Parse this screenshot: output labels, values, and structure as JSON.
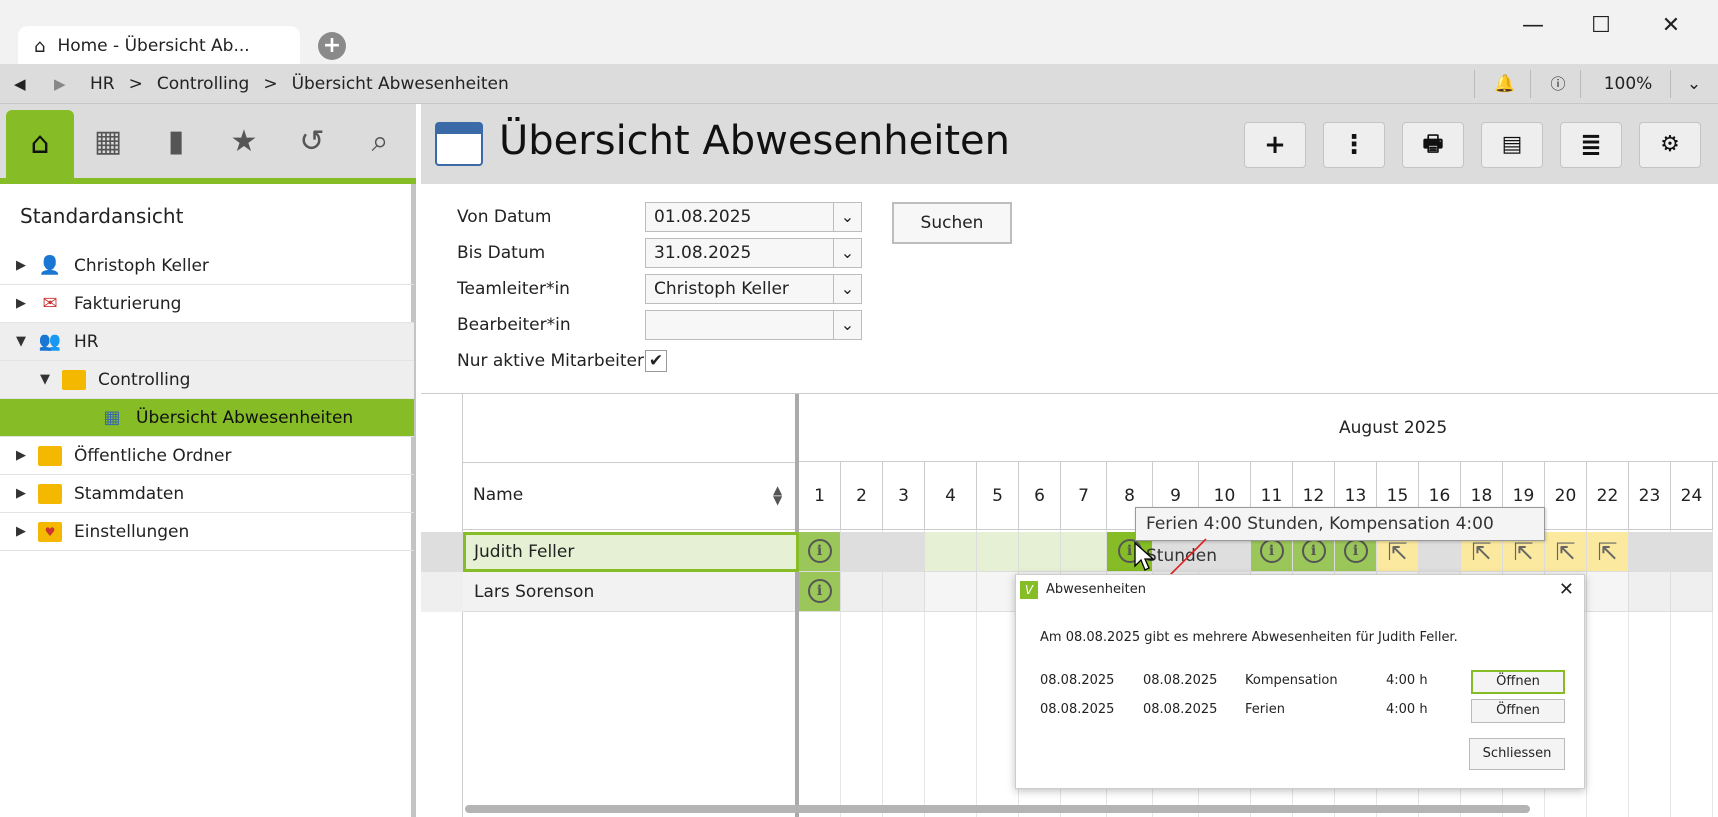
{
  "window": {
    "tab_title": "Home - Übersicht Ab...",
    "minimize": "—",
    "maximize": "☐",
    "close": "✕"
  },
  "breadcrumb": {
    "items": [
      "HR",
      ">",
      "Controlling",
      ">",
      "Übersicht Abwesenheiten"
    ],
    "zoom": "100%"
  },
  "sidebar": {
    "title": "Standardansicht",
    "icons": [
      "home-icon",
      "calendar-icon",
      "bar-chart-icon",
      "star-icon",
      "history-icon",
      "search-icon"
    ],
    "tree": [
      {
        "label": "Christoph Keller",
        "toggle": "▶",
        "icon": "user-icon"
      },
      {
        "label": "Fakturierung",
        "toggle": "▶",
        "icon": "invoice-icon"
      },
      {
        "label": "HR",
        "toggle": "▼",
        "icon": "group-icon"
      },
      {
        "label": "Controlling",
        "toggle": "▼",
        "icon": "folder-icon"
      },
      {
        "label": "Übersicht Abwesenheiten",
        "toggle": "",
        "icon": "calendar-icon"
      },
      {
        "label": "Öffentliche Ordner",
        "toggle": "▶",
        "icon": "folder-icon"
      },
      {
        "label": "Stammdaten",
        "toggle": "▶",
        "icon": "folder-icon"
      },
      {
        "label": "Einstellungen",
        "toggle": "▶",
        "icon": "settings-folder-icon"
      }
    ]
  },
  "header": {
    "title": "Übersicht Abwesenheiten"
  },
  "toolbar": [
    "+",
    "⋮",
    "🖶",
    "▤",
    "≣",
    "⚙"
  ],
  "filters": {
    "von_label": "Von Datum",
    "von_value": "01.08.2025",
    "bis_label": "Bis Datum",
    "bis_value": "31.08.2025",
    "team_label": "Teamleiter*in",
    "team_value": "Christoph Keller",
    "bearb_label": "Bearbeiter*in",
    "bearb_value": "",
    "aktiv_label": "Nur aktive Mitarbeiter",
    "aktiv_checked": "✔",
    "search_label": "Suchen"
  },
  "grid": {
    "month": "August 2025",
    "name_header": "Name",
    "days": [
      "1",
      "2",
      "3",
      "4",
      "5",
      "6",
      "7",
      "8",
      "9",
      "10",
      "11",
      "12",
      "13",
      "15",
      "16",
      "18",
      "19",
      "20",
      "22",
      "23",
      "24"
    ],
    "rows": [
      {
        "name": "Judith Feller"
      },
      {
        "name": "Lars Sorenson"
      }
    ],
    "info_glyph": "i",
    "ext_glyph": "⇱"
  },
  "tooltip": "Ferien 4:00 Stunden, Kompensation 4:00 Stunden",
  "dialog": {
    "title": "Abwesenheiten",
    "message": "Am 08.08.2025 gibt es mehrere Abwesenheiten für Judith Feller.",
    "rows": [
      {
        "from": "08.08.2025",
        "to": "08.08.2025",
        "type": "Kompensation",
        "hours": "4:00 h",
        "button": "Öffnen"
      },
      {
        "from": "08.08.2025",
        "to": "08.08.2025",
        "type": "Ferien",
        "hours": "4:00 h",
        "button": "Öffnen"
      }
    ],
    "close_button": "Schliessen"
  },
  "colors": {
    "accent": "#86bc25",
    "light_green": "#e6f0d4",
    "yellow": "#fbe9a0",
    "weekend": "#dedede"
  }
}
